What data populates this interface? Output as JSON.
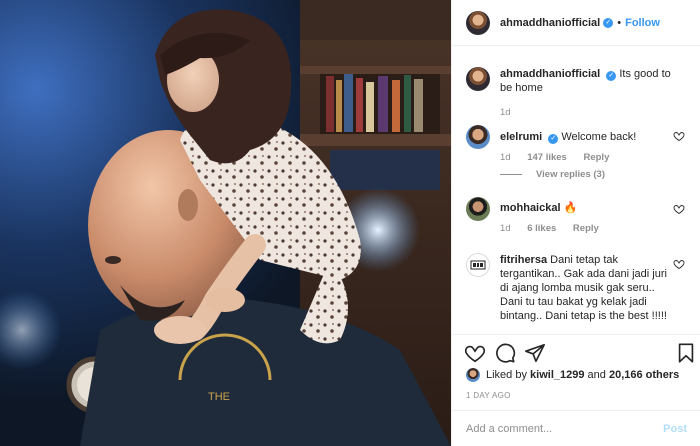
{
  "header": {
    "username": "ahmaddhaniofficial",
    "separator": "•",
    "follow_label": "Follow",
    "verified_glyph": "✓"
  },
  "photo": {
    "shirt_print": "THE"
  },
  "comments": [
    {
      "username": "ahmaddhaniofficial",
      "verified": true,
      "text": "Its good to be home",
      "time": "1d"
    },
    {
      "username": "elelrumi",
      "verified": true,
      "text": "Welcome back!",
      "time": "1d",
      "likes": "147 likes",
      "reply": "Reply",
      "view_replies": "View replies (3)"
    },
    {
      "username": "mohhaickal",
      "verified": false,
      "text": "🔥",
      "time": "1d",
      "likes": "6 likes",
      "reply": "Reply"
    },
    {
      "username": "fitrihersa",
      "verified": false,
      "text": "Dani tetap tak tergantikan.. Gak ada dani jadi juri di ajang lomba musik gak seru.. Dani tu tau bakat yg kelak jadi bintang.. Dani tetap is the best !!!!!"
    }
  ],
  "likes": {
    "prefix": "Liked by",
    "liker": "kiwil_1299",
    "connector": "and",
    "others": "20,166 others"
  },
  "date": "1 DAY AGO",
  "add_comment": {
    "placeholder": "Add a comment...",
    "post_label": "Post"
  },
  "icons": {
    "like": "heart-icon",
    "comment": "comment-bubble-icon",
    "share": "paper-plane-icon",
    "save": "bookmark-icon"
  },
  "colors": {
    "accent": "#3897f0",
    "muted": "#8e8e8e",
    "border": "#efefef",
    "post_disabled": "#b2dffc"
  }
}
